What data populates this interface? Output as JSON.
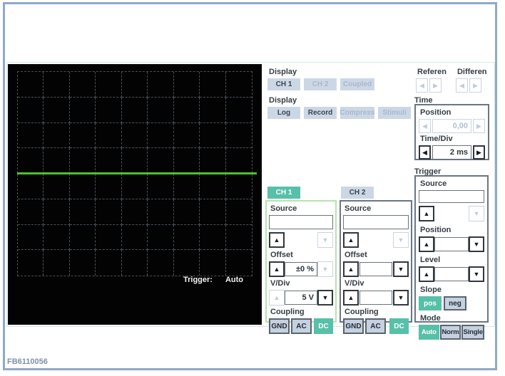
{
  "window": {
    "figure_label": "FB6110056"
  },
  "icons": {
    "up": "▲",
    "down": "▼",
    "left": "◀",
    "right": "▶"
  },
  "colors": {
    "accent_teal": "#57c0a8",
    "trace_green": "#4ec12f",
    "button_blue": "#ccd7e6",
    "frame_blue": "#8fa9c6"
  },
  "scope": {
    "trigger_label": "Trigger:",
    "trigger_mode": "Auto"
  },
  "display_channels": {
    "label": "Display",
    "buttons": [
      {
        "label": "CH 1",
        "state": "active"
      },
      {
        "label": "CH 2",
        "state": "disabled"
      },
      {
        "label": "Coupled",
        "state": "disabled"
      }
    ]
  },
  "display_modes": {
    "label": "Display",
    "buttons": [
      {
        "label": "Log",
        "state": "active"
      },
      {
        "label": "Record",
        "state": "active"
      },
      {
        "label": "Compress",
        "state": "disabled"
      },
      {
        "label": "Stimuli",
        "state": "disabled"
      }
    ]
  },
  "reference": {
    "label": "Referen"
  },
  "difference": {
    "label": "Differen"
  },
  "time": {
    "label": "Time",
    "position": {
      "label": "Position",
      "value": "0,00"
    },
    "time_div": {
      "label": "Time/Div",
      "value": "2 ms"
    }
  },
  "trigger": {
    "label": "Trigger",
    "source": {
      "label": "Source",
      "value": ""
    },
    "position": {
      "label": "Position",
      "value": ""
    },
    "level": {
      "label": "Level",
      "value": ""
    },
    "slope": {
      "label": "Slope",
      "pos": "pos",
      "neg": "neg",
      "selected": "pos"
    },
    "mode": {
      "label": "Mode",
      "auto": "Auto",
      "norm": "Norm",
      "single": "Single",
      "selected": "Auto"
    }
  },
  "channel1": {
    "button": "CH 1",
    "source": {
      "label": "Source",
      "value": ""
    },
    "offset": {
      "label": "Offset",
      "value": "±0 %"
    },
    "v_div": {
      "label": "V/Div",
      "value": "5 V"
    },
    "coupling": {
      "label": "Coupling",
      "gnd": "GND",
      "ac": "AC",
      "dc": "DC",
      "selected": "DC"
    }
  },
  "channel2": {
    "button": "CH 2",
    "source": {
      "label": "Source",
      "value": ""
    },
    "offset": {
      "label": "Offset",
      "value": ""
    },
    "v_div": {
      "label": "V/Div",
      "value": ""
    },
    "coupling": {
      "label": "Coupling",
      "gnd": "GND",
      "ac": "AC",
      "dc": "DC",
      "selected": "DC"
    }
  }
}
